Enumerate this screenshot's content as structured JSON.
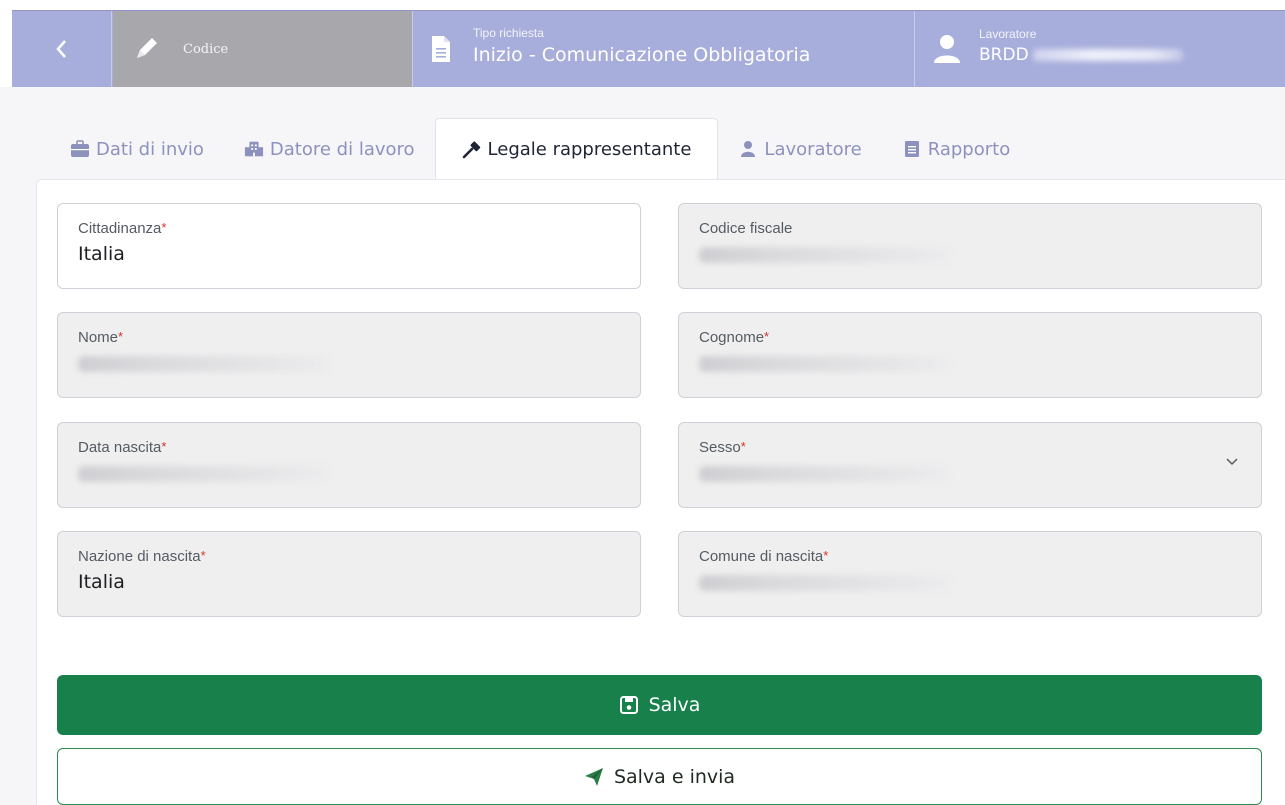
{
  "header": {
    "back_icon": "chevron-left-icon",
    "code_label": "Codice",
    "tipo_small": "Tipo richiesta",
    "tipo_value": "Inizio - Comunicazione Obbligatoria",
    "lavoratore_small": "Lavoratore",
    "lavoratore_value": "BRDD"
  },
  "tabs": [
    {
      "label": "Dati di invio",
      "icon": "briefcase-icon"
    },
    {
      "label": "Datore di lavoro",
      "icon": "building-icon"
    },
    {
      "label": "Legale rappresentante",
      "icon": "gavel-icon",
      "active": true
    },
    {
      "label": "Lavoratore",
      "icon": "user-icon"
    },
    {
      "label": "Rapporto",
      "icon": "bookmark-document-icon"
    }
  ],
  "form": {
    "cittadinanza": {
      "label": "Cittadinanza",
      "value": "Italia"
    },
    "codice_fiscale": {
      "label": "Codice fiscale"
    },
    "nome": {
      "label": "Nome"
    },
    "cognome": {
      "label": "Cognome"
    },
    "data_nascita": {
      "label": "Data nascita"
    },
    "sesso": {
      "label": "Sesso"
    },
    "nazione_nascita": {
      "label": "Nazione di nascita",
      "value": "Italia"
    },
    "comune_nascita": {
      "label": "Comune di nascita"
    },
    "required_mark": "*"
  },
  "buttons": {
    "save_label": "Salva",
    "save_send_label": "Salva e invia"
  },
  "colors": {
    "header_bg": "#a8aedb",
    "accent_green": "#18814b",
    "tab_inactive": "#8c92bd"
  }
}
